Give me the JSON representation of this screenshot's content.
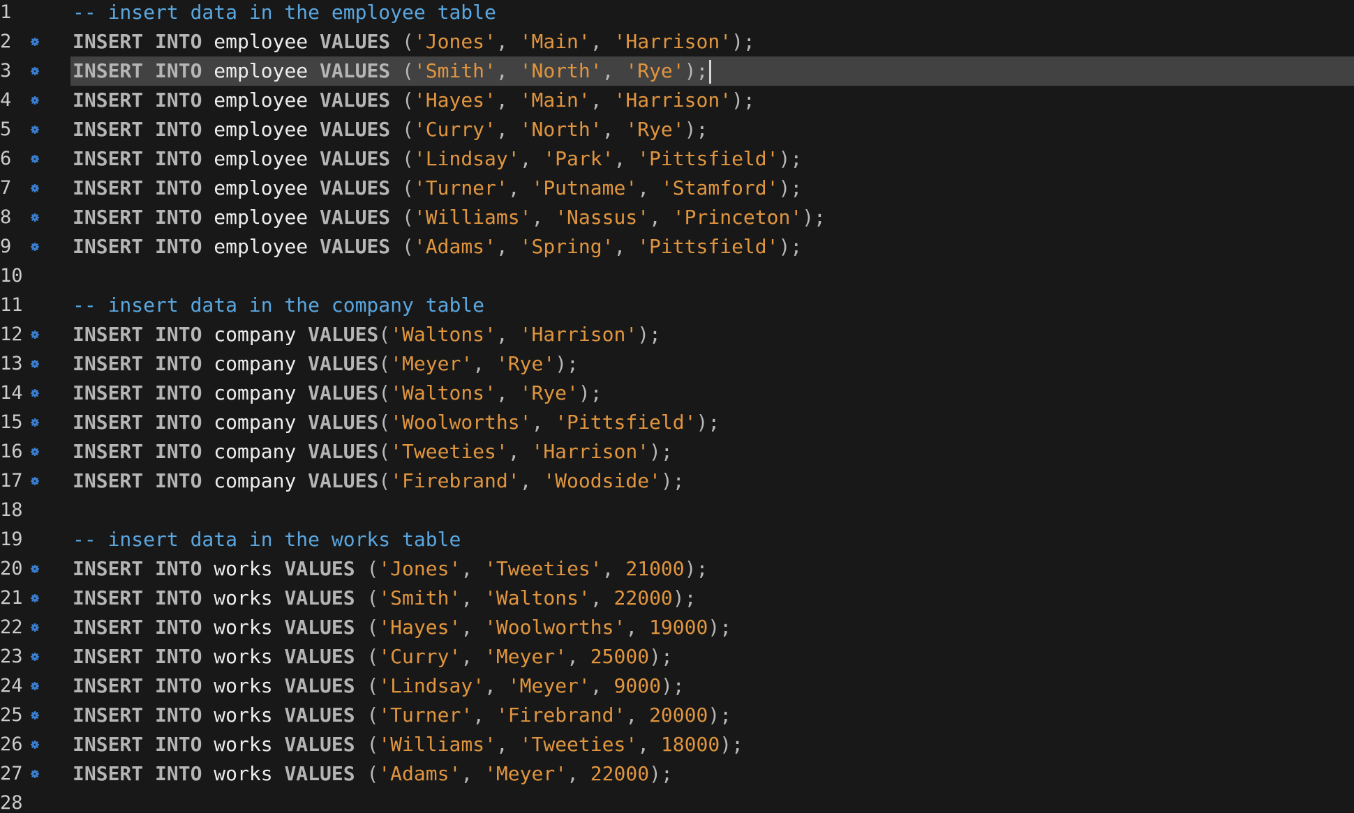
{
  "editor": {
    "current_line": 3,
    "lines": [
      {
        "n": "1",
        "marker": false,
        "tokens": [
          {
            "t": "cmt",
            "v": "-- insert data in the employee table"
          }
        ]
      },
      {
        "n": "2",
        "marker": true,
        "tokens": [
          {
            "t": "kw",
            "v": "INSERT INTO "
          },
          {
            "t": "id",
            "v": "employee "
          },
          {
            "t": "kw",
            "v": "VALUES "
          },
          {
            "t": "punc",
            "v": "("
          },
          {
            "t": "str",
            "v": "'Jones'"
          },
          {
            "t": "punc",
            "v": ", "
          },
          {
            "t": "str",
            "v": "'Main'"
          },
          {
            "t": "punc",
            "v": ", "
          },
          {
            "t": "str",
            "v": "'Harrison'"
          },
          {
            "t": "punc",
            "v": ");"
          }
        ]
      },
      {
        "n": "3",
        "marker": true,
        "tokens": [
          {
            "t": "kw",
            "v": "INSERT INTO "
          },
          {
            "t": "id",
            "v": "employee "
          },
          {
            "t": "kw",
            "v": "VALUES "
          },
          {
            "t": "punc",
            "v": "("
          },
          {
            "t": "str",
            "v": "'Smith'"
          },
          {
            "t": "punc",
            "v": ", "
          },
          {
            "t": "str",
            "v": "'North'"
          },
          {
            "t": "punc",
            "v": ", "
          },
          {
            "t": "str",
            "v": "'Rye'"
          },
          {
            "t": "punc",
            "v": ");"
          }
        ]
      },
      {
        "n": "4",
        "marker": true,
        "tokens": [
          {
            "t": "kw",
            "v": "INSERT INTO "
          },
          {
            "t": "id",
            "v": "employee "
          },
          {
            "t": "kw",
            "v": "VALUES "
          },
          {
            "t": "punc",
            "v": "("
          },
          {
            "t": "str",
            "v": "'Hayes'"
          },
          {
            "t": "punc",
            "v": ", "
          },
          {
            "t": "str",
            "v": "'Main'"
          },
          {
            "t": "punc",
            "v": ", "
          },
          {
            "t": "str",
            "v": "'Harrison'"
          },
          {
            "t": "punc",
            "v": ");"
          }
        ]
      },
      {
        "n": "5",
        "marker": true,
        "tokens": [
          {
            "t": "kw",
            "v": "INSERT INTO "
          },
          {
            "t": "id",
            "v": "employee "
          },
          {
            "t": "kw",
            "v": "VALUES "
          },
          {
            "t": "punc",
            "v": "("
          },
          {
            "t": "str",
            "v": "'Curry'"
          },
          {
            "t": "punc",
            "v": ", "
          },
          {
            "t": "str",
            "v": "'North'"
          },
          {
            "t": "punc",
            "v": ", "
          },
          {
            "t": "str",
            "v": "'Rye'"
          },
          {
            "t": "punc",
            "v": ");"
          }
        ]
      },
      {
        "n": "6",
        "marker": true,
        "tokens": [
          {
            "t": "kw",
            "v": "INSERT INTO "
          },
          {
            "t": "id",
            "v": "employee "
          },
          {
            "t": "kw",
            "v": "VALUES "
          },
          {
            "t": "punc",
            "v": "("
          },
          {
            "t": "str",
            "v": "'Lindsay'"
          },
          {
            "t": "punc",
            "v": ", "
          },
          {
            "t": "str",
            "v": "'Park'"
          },
          {
            "t": "punc",
            "v": ", "
          },
          {
            "t": "str",
            "v": "'Pittsfield'"
          },
          {
            "t": "punc",
            "v": ");"
          }
        ]
      },
      {
        "n": "7",
        "marker": true,
        "tokens": [
          {
            "t": "kw",
            "v": "INSERT INTO "
          },
          {
            "t": "id",
            "v": "employee "
          },
          {
            "t": "kw",
            "v": "VALUES "
          },
          {
            "t": "punc",
            "v": "("
          },
          {
            "t": "str",
            "v": "'Turner'"
          },
          {
            "t": "punc",
            "v": ", "
          },
          {
            "t": "str",
            "v": "'Putname'"
          },
          {
            "t": "punc",
            "v": ", "
          },
          {
            "t": "str",
            "v": "'Stamford'"
          },
          {
            "t": "punc",
            "v": ");"
          }
        ]
      },
      {
        "n": "8",
        "marker": true,
        "tokens": [
          {
            "t": "kw",
            "v": "INSERT INTO "
          },
          {
            "t": "id",
            "v": "employee "
          },
          {
            "t": "kw",
            "v": "VALUES "
          },
          {
            "t": "punc",
            "v": "("
          },
          {
            "t": "str",
            "v": "'Williams'"
          },
          {
            "t": "punc",
            "v": ", "
          },
          {
            "t": "str",
            "v": "'Nassus'"
          },
          {
            "t": "punc",
            "v": ", "
          },
          {
            "t": "str",
            "v": "'Princeton'"
          },
          {
            "t": "punc",
            "v": ");"
          }
        ]
      },
      {
        "n": "9",
        "marker": true,
        "tokens": [
          {
            "t": "kw",
            "v": "INSERT INTO "
          },
          {
            "t": "id",
            "v": "employee "
          },
          {
            "t": "kw",
            "v": "VALUES "
          },
          {
            "t": "punc",
            "v": "("
          },
          {
            "t": "str",
            "v": "'Adams'"
          },
          {
            "t": "punc",
            "v": ", "
          },
          {
            "t": "str",
            "v": "'Spring'"
          },
          {
            "t": "punc",
            "v": ", "
          },
          {
            "t": "str",
            "v": "'Pittsfield'"
          },
          {
            "t": "punc",
            "v": ");"
          }
        ]
      },
      {
        "n": "10",
        "marker": false,
        "tokens": []
      },
      {
        "n": "11",
        "marker": false,
        "tokens": [
          {
            "t": "cmt",
            "v": "-- insert data in the company table"
          }
        ]
      },
      {
        "n": "12",
        "marker": true,
        "tokens": [
          {
            "t": "kw",
            "v": "INSERT INTO "
          },
          {
            "t": "id",
            "v": "company "
          },
          {
            "t": "kw",
            "v": "VALUES"
          },
          {
            "t": "punc",
            "v": "("
          },
          {
            "t": "str",
            "v": "'Waltons'"
          },
          {
            "t": "punc",
            "v": ", "
          },
          {
            "t": "str",
            "v": "'Harrison'"
          },
          {
            "t": "punc",
            "v": ");"
          }
        ]
      },
      {
        "n": "13",
        "marker": true,
        "tokens": [
          {
            "t": "kw",
            "v": "INSERT INTO "
          },
          {
            "t": "id",
            "v": "company "
          },
          {
            "t": "kw",
            "v": "VALUES"
          },
          {
            "t": "punc",
            "v": "("
          },
          {
            "t": "str",
            "v": "'Meyer'"
          },
          {
            "t": "punc",
            "v": ", "
          },
          {
            "t": "str",
            "v": "'Rye'"
          },
          {
            "t": "punc",
            "v": ");"
          }
        ]
      },
      {
        "n": "14",
        "marker": true,
        "tokens": [
          {
            "t": "kw",
            "v": "INSERT INTO "
          },
          {
            "t": "id",
            "v": "company "
          },
          {
            "t": "kw",
            "v": "VALUES"
          },
          {
            "t": "punc",
            "v": "("
          },
          {
            "t": "str",
            "v": "'Waltons'"
          },
          {
            "t": "punc",
            "v": ", "
          },
          {
            "t": "str",
            "v": "'Rye'"
          },
          {
            "t": "punc",
            "v": ");"
          }
        ]
      },
      {
        "n": "15",
        "marker": true,
        "tokens": [
          {
            "t": "kw",
            "v": "INSERT INTO "
          },
          {
            "t": "id",
            "v": "company "
          },
          {
            "t": "kw",
            "v": "VALUES"
          },
          {
            "t": "punc",
            "v": "("
          },
          {
            "t": "str",
            "v": "'Woolworths'"
          },
          {
            "t": "punc",
            "v": ", "
          },
          {
            "t": "str",
            "v": "'Pittsfield'"
          },
          {
            "t": "punc",
            "v": ");"
          }
        ]
      },
      {
        "n": "16",
        "marker": true,
        "tokens": [
          {
            "t": "kw",
            "v": "INSERT INTO "
          },
          {
            "t": "id",
            "v": "company "
          },
          {
            "t": "kw",
            "v": "VALUES"
          },
          {
            "t": "punc",
            "v": "("
          },
          {
            "t": "str",
            "v": "'Tweeties'"
          },
          {
            "t": "punc",
            "v": ", "
          },
          {
            "t": "str",
            "v": "'Harrison'"
          },
          {
            "t": "punc",
            "v": ");"
          }
        ]
      },
      {
        "n": "17",
        "marker": true,
        "tokens": [
          {
            "t": "kw",
            "v": "INSERT INTO "
          },
          {
            "t": "id",
            "v": "company "
          },
          {
            "t": "kw",
            "v": "VALUES"
          },
          {
            "t": "punc",
            "v": "("
          },
          {
            "t": "str",
            "v": "'Firebrand'"
          },
          {
            "t": "punc",
            "v": ", "
          },
          {
            "t": "str",
            "v": "'Woodside'"
          },
          {
            "t": "punc",
            "v": ");"
          }
        ]
      },
      {
        "n": "18",
        "marker": false,
        "tokens": []
      },
      {
        "n": "19",
        "marker": false,
        "tokens": [
          {
            "t": "cmt",
            "v": "-- insert data in the works table"
          }
        ]
      },
      {
        "n": "20",
        "marker": true,
        "tokens": [
          {
            "t": "kw",
            "v": "INSERT INTO "
          },
          {
            "t": "id",
            "v": "works "
          },
          {
            "t": "kw",
            "v": "VALUES "
          },
          {
            "t": "punc",
            "v": "("
          },
          {
            "t": "str",
            "v": "'Jones'"
          },
          {
            "t": "punc",
            "v": ", "
          },
          {
            "t": "str",
            "v": "'Tweeties'"
          },
          {
            "t": "punc",
            "v": ", "
          },
          {
            "t": "num",
            "v": "21000"
          },
          {
            "t": "punc",
            "v": ");"
          }
        ]
      },
      {
        "n": "21",
        "marker": true,
        "tokens": [
          {
            "t": "kw",
            "v": "INSERT INTO "
          },
          {
            "t": "id",
            "v": "works "
          },
          {
            "t": "kw",
            "v": "VALUES "
          },
          {
            "t": "punc",
            "v": "("
          },
          {
            "t": "str",
            "v": "'Smith'"
          },
          {
            "t": "punc",
            "v": ", "
          },
          {
            "t": "str",
            "v": "'Waltons'"
          },
          {
            "t": "punc",
            "v": ", "
          },
          {
            "t": "num",
            "v": "22000"
          },
          {
            "t": "punc",
            "v": ");"
          }
        ]
      },
      {
        "n": "22",
        "marker": true,
        "tokens": [
          {
            "t": "kw",
            "v": "INSERT INTO "
          },
          {
            "t": "id",
            "v": "works "
          },
          {
            "t": "kw",
            "v": "VALUES "
          },
          {
            "t": "punc",
            "v": "("
          },
          {
            "t": "str",
            "v": "'Hayes'"
          },
          {
            "t": "punc",
            "v": ", "
          },
          {
            "t": "str",
            "v": "'Woolworths'"
          },
          {
            "t": "punc",
            "v": ", "
          },
          {
            "t": "num",
            "v": "19000"
          },
          {
            "t": "punc",
            "v": ");"
          }
        ]
      },
      {
        "n": "23",
        "marker": true,
        "tokens": [
          {
            "t": "kw",
            "v": "INSERT INTO "
          },
          {
            "t": "id",
            "v": "works "
          },
          {
            "t": "kw",
            "v": "VALUES "
          },
          {
            "t": "punc",
            "v": "("
          },
          {
            "t": "str",
            "v": "'Curry'"
          },
          {
            "t": "punc",
            "v": ", "
          },
          {
            "t": "str",
            "v": "'Meyer'"
          },
          {
            "t": "punc",
            "v": ", "
          },
          {
            "t": "num",
            "v": "25000"
          },
          {
            "t": "punc",
            "v": ");"
          }
        ]
      },
      {
        "n": "24",
        "marker": true,
        "tokens": [
          {
            "t": "kw",
            "v": "INSERT INTO "
          },
          {
            "t": "id",
            "v": "works "
          },
          {
            "t": "kw",
            "v": "VALUES "
          },
          {
            "t": "punc",
            "v": "("
          },
          {
            "t": "str",
            "v": "'Lindsay'"
          },
          {
            "t": "punc",
            "v": ", "
          },
          {
            "t": "str",
            "v": "'Meyer'"
          },
          {
            "t": "punc",
            "v": ", "
          },
          {
            "t": "num",
            "v": "9000"
          },
          {
            "t": "punc",
            "v": ");"
          }
        ]
      },
      {
        "n": "25",
        "marker": true,
        "tokens": [
          {
            "t": "kw",
            "v": "INSERT INTO "
          },
          {
            "t": "id",
            "v": "works "
          },
          {
            "t": "kw",
            "v": "VALUES "
          },
          {
            "t": "punc",
            "v": "("
          },
          {
            "t": "str",
            "v": "'Turner'"
          },
          {
            "t": "punc",
            "v": ", "
          },
          {
            "t": "str",
            "v": "'Firebrand'"
          },
          {
            "t": "punc",
            "v": ", "
          },
          {
            "t": "num",
            "v": "20000"
          },
          {
            "t": "punc",
            "v": ");"
          }
        ]
      },
      {
        "n": "26",
        "marker": true,
        "tokens": [
          {
            "t": "kw",
            "v": "INSERT INTO "
          },
          {
            "t": "id",
            "v": "works "
          },
          {
            "t": "kw",
            "v": "VALUES "
          },
          {
            "t": "punc",
            "v": "("
          },
          {
            "t": "str",
            "v": "'Williams'"
          },
          {
            "t": "punc",
            "v": ", "
          },
          {
            "t": "str",
            "v": "'Tweeties'"
          },
          {
            "t": "punc",
            "v": ", "
          },
          {
            "t": "num",
            "v": "18000"
          },
          {
            "t": "punc",
            "v": ");"
          }
        ]
      },
      {
        "n": "27",
        "marker": true,
        "tokens": [
          {
            "t": "kw",
            "v": "INSERT INTO "
          },
          {
            "t": "id",
            "v": "works "
          },
          {
            "t": "kw",
            "v": "VALUES "
          },
          {
            "t": "punc",
            "v": "("
          },
          {
            "t": "str",
            "v": "'Adams'"
          },
          {
            "t": "punc",
            "v": ", "
          },
          {
            "t": "str",
            "v": "'Meyer'"
          },
          {
            "t": "punc",
            "v": ", "
          },
          {
            "t": "num",
            "v": "22000"
          },
          {
            "t": "punc",
            "v": ");"
          }
        ]
      },
      {
        "n": "28",
        "marker": false,
        "tokens": []
      }
    ]
  },
  "colors": {
    "background": "#181818",
    "current_line_highlight": "#424242",
    "marker": "#3b82d6",
    "comment": "#5aa7e0",
    "string": "#e0953f"
  },
  "icons": {
    "gutter_marker": "gear-dot-icon"
  }
}
